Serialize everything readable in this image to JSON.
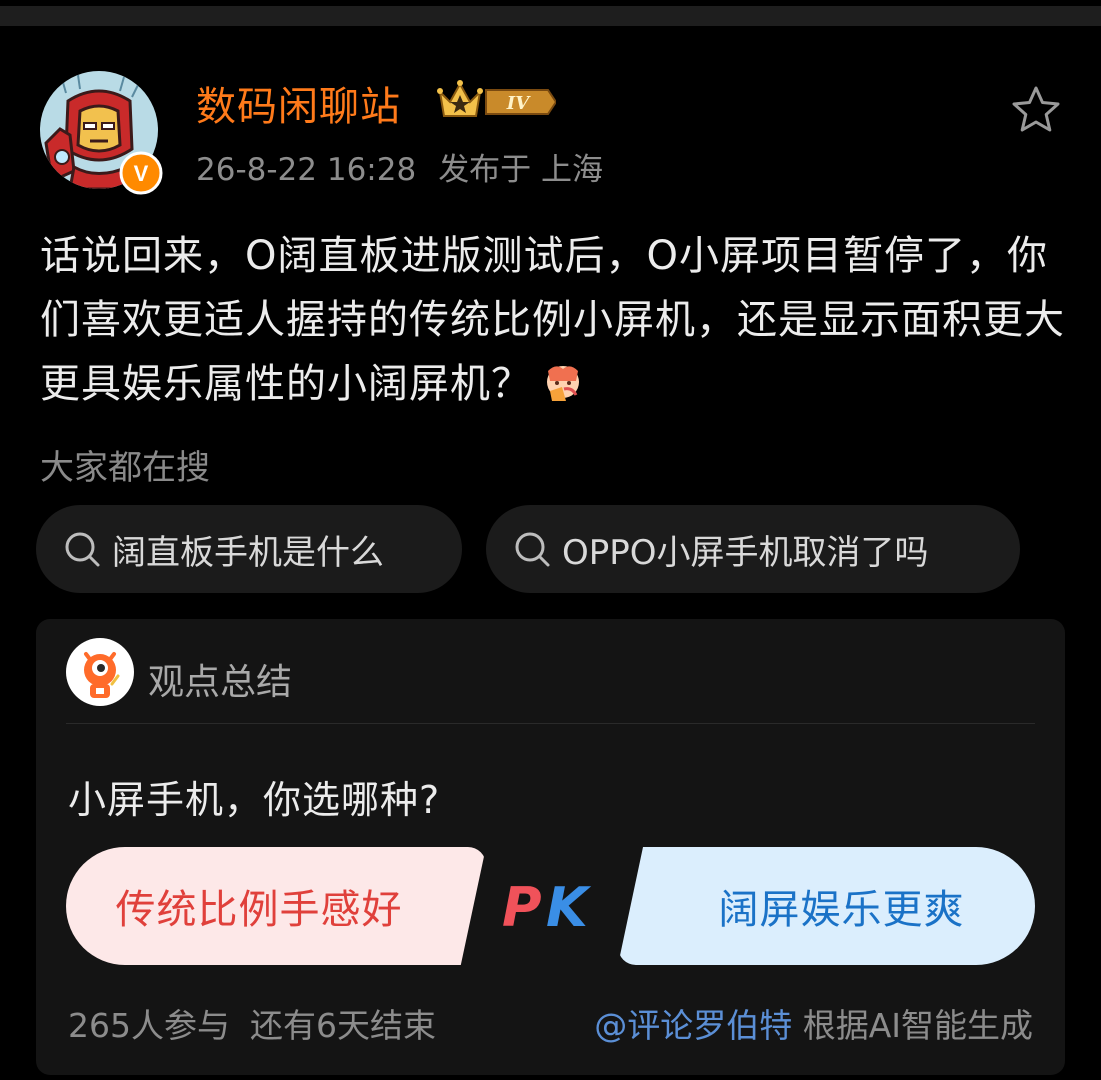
{
  "post": {
    "author_name": "数码闲聊站",
    "level_badge": "IV",
    "time": "26-8-22 16:28",
    "location": "发布于 上海",
    "text": "话说回来，O阔直板进版测试后，O小屏项目暂停了，你们喜欢更适人握持的传统比例小屏机，还是显示面积更大更具娱乐属性的小阔屏机？",
    "verified_badge": "V",
    "icons": [
      "iron-man-avatar",
      "verified-icon",
      "crown-level-icon",
      "star-icon",
      "emoji-icon"
    ]
  },
  "search": {
    "heading": "大家都在搜",
    "chips": [
      "阔直板手机是什么",
      "OPPO小屏手机取消了吗"
    ]
  },
  "summary": {
    "title": "观点总结",
    "question": "小屏手机，你选哪种?",
    "option_left": "传统比例手感好",
    "option_right": "阔屏娱乐更爽",
    "pk_label": "PK",
    "participants": "265人参与",
    "remaining": "还有6天结束",
    "mention": "@评论罗伯特",
    "generated": "根据AI智能生成"
  },
  "colors": {
    "author": "#ff7a1a",
    "option_left_bg": "#fde8e8",
    "option_left_text": "#e0403b",
    "option_right_bg": "#dbeefd",
    "option_right_text": "#1a72c7",
    "mention": "#5b8fd6"
  }
}
